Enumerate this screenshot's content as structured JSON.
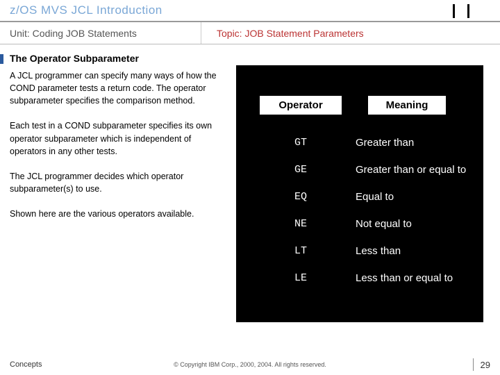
{
  "header": {
    "title": "z/OS MVS JCL Introduction",
    "unit": "Unit: Coding JOB Statements",
    "topic": "Topic: JOB Statement Parameters"
  },
  "section_heading": "The Operator Subparameter",
  "paragraphs": [
    "A JCL programmer can specify many ways of how the COND parameter tests a return code. The operator subparameter specifies the comparison method.",
    "Each test in a COND subparameter specifies its own operator subparameter which is independent of operators in any other tests.",
    "The JCL programmer decides which operator subparameter(s) to use.",
    "Shown here are the various operators available."
  ],
  "table": {
    "head_operator": "Operator",
    "head_meaning": "Meaning",
    "rows": [
      {
        "code": "GT",
        "meaning": "Greater than"
      },
      {
        "code": "GE",
        "meaning": "Greater than or equal to"
      },
      {
        "code": "EQ",
        "meaning": "Equal to"
      },
      {
        "code": "NE",
        "meaning": "Not equal to"
      },
      {
        "code": "LT",
        "meaning": "Less than"
      },
      {
        "code": "LE",
        "meaning": "Less than or equal to"
      }
    ]
  },
  "footer": {
    "left": "Concepts",
    "copyright": "© Copyright IBM Corp., 2000, 2004. All rights reserved.",
    "page": "29"
  }
}
